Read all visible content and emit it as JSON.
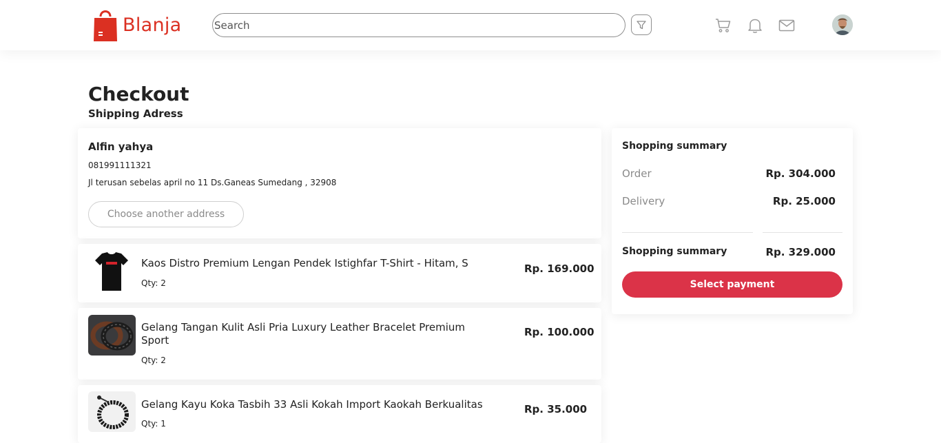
{
  "brand": {
    "name": "Blanja",
    "color": "#db3022"
  },
  "header": {
    "search_placeholder": "Search",
    "icons": [
      "filter-icon",
      "cart-icon",
      "bell-icon",
      "mail-icon"
    ]
  },
  "page": {
    "title": "Checkout",
    "subtitle": "Shipping Adress"
  },
  "address": {
    "name": "Alfin yahya",
    "phone": "081991111321",
    "line": "Jl terusan sebelas april no 11 Ds.Ganeas Sumedang , 32908",
    "button": "Choose another address"
  },
  "items": [
    {
      "name": "Kaos Distro Premium Lengan Pendek Istighfar T-Shirt - Hitam, S",
      "qty": "Qty: 2",
      "price": "Rp. 169.000",
      "thumb": "tshirt"
    },
    {
      "name": "Gelang Tangan Kulit Asli Pria Luxury Leather Bracelet Premium Sport",
      "qty": "Qty: 2",
      "price": "Rp. 100.000",
      "thumb": "leather-bracelet"
    },
    {
      "name": "Gelang Kayu Koka Tasbih 33 Asli Kokah Import Kaokah Berkualitas",
      "qty": "Qty: 1",
      "price": "Rp. 35.000",
      "thumb": "wood-bracelet"
    }
  ],
  "summary": {
    "title": "Shopping summary",
    "order_label": "Order",
    "order_value": "Rp. 304.000",
    "delivery_label": "Delivery",
    "delivery_value": "Rp. 25.000",
    "total_label": "Shopping summary",
    "total_value": "Rp. 329.000",
    "pay_button": "Select payment",
    "accent": "#db3348"
  }
}
